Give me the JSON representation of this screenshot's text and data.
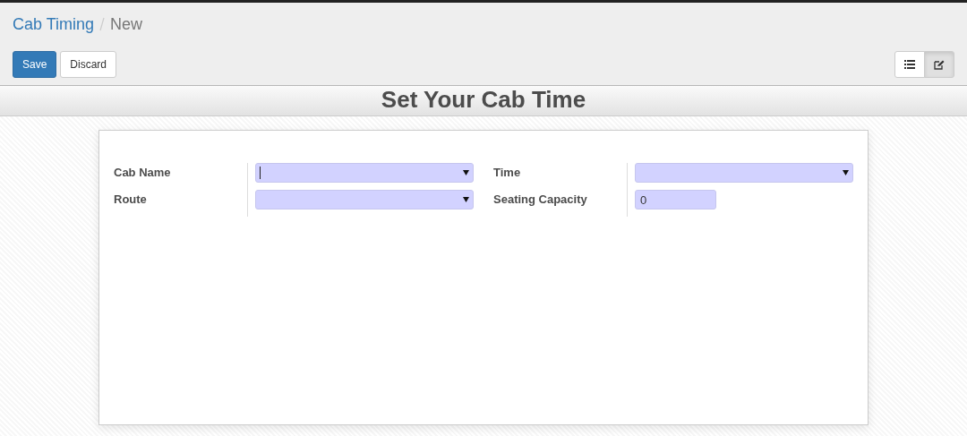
{
  "breadcrumbs": [
    {
      "label": "Cab Timing",
      "active": false
    },
    {
      "label": "New",
      "active": true
    }
  ],
  "buttons": [
    {
      "label": "Save",
      "kind": "primary"
    },
    {
      "label": "Discard",
      "kind": "secondary"
    }
  ],
  "view_switcher": [
    {
      "kind": "list",
      "selected": false
    },
    {
      "kind": "form",
      "selected": true
    }
  ],
  "heading": "Set Your Cab Time",
  "groups": [
    {
      "fields": [
        {
          "label": "Cab Name",
          "kind": "select",
          "focused": true
        },
        {
          "label": "Route",
          "kind": "select",
          "focused": false
        }
      ]
    },
    {
      "fields": [
        {
          "label": "Time",
          "kind": "select",
          "focused": false
        },
        {
          "label": "Seating Capacity",
          "kind": "number",
          "value": "0",
          "focused": false
        }
      ]
    }
  ]
}
